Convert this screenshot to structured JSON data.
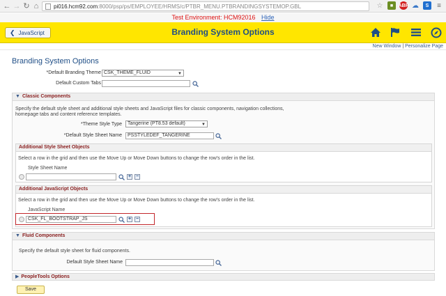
{
  "browser": {
    "url_host": "pi016.hcm92.com",
    "url_path": ":8000/psp/ps/EMPLOYEE/HRMS/c/PTBR_MENU.PTBRANDINGSYSTEMOP.GBL"
  },
  "env_bar": {
    "text": "Test Environment: HCM92016",
    "hide_label": "Hide"
  },
  "header": {
    "back_label": "JavaScript",
    "title": "Branding System Options"
  },
  "links": {
    "new_window": "New Window",
    "separator": "|",
    "personalize": "Personalize Page"
  },
  "page_title": "Branding System Options",
  "top_fields": {
    "default_theme_label": "*Default Branding Theme",
    "default_theme_value": "CSK_THEME_FLUID",
    "default_tabs_label": "Default Custom Tabs",
    "default_tabs_value": ""
  },
  "classic": {
    "header": "Classic Components",
    "description_line1": "Specify the default style sheet and additional style sheets and JavaScript files for classic components, navigation collections,",
    "description_line2": "homepage tabs and content reference templates.",
    "theme_style_label": "*Theme Style Type",
    "theme_style_value": "Tangerine (PT8.53 default)",
    "default_style_label": "*Default Style Sheet Name",
    "default_style_value": "PSSTYLEDEF_TANGERINE"
  },
  "style_sheets": {
    "header": "Additional Style Sheet Objects",
    "instructions": "Select a row in the grid and then use the Move Up or Move Down buttons to change the row's order in the list.",
    "column_label": "Style Sheet Name",
    "row_value": ""
  },
  "javascript": {
    "header": "Additional JavaScript Objects",
    "instructions": "Select a row in the grid and then use the Move Up or Move Down buttons to change the row's order in the list.",
    "column_label": "JavaScript Name",
    "row_value": "CSK_FL_BOOTSTRAP_JS"
  },
  "fluid": {
    "header": "Fluid Components",
    "description": "Specify the default style sheet for fluid components.",
    "default_style_label": "Default Style Sheet Name",
    "default_style_value": ""
  },
  "peopletools": {
    "header": "PeopleTools Options"
  },
  "buttons": {
    "add": "+",
    "remove": "−",
    "save": "Save"
  },
  "colors": {
    "header_bg": "#ffe600",
    "title_blue": "#1f4e86",
    "section_red": "#8a2020",
    "env_red": "#d11111"
  }
}
